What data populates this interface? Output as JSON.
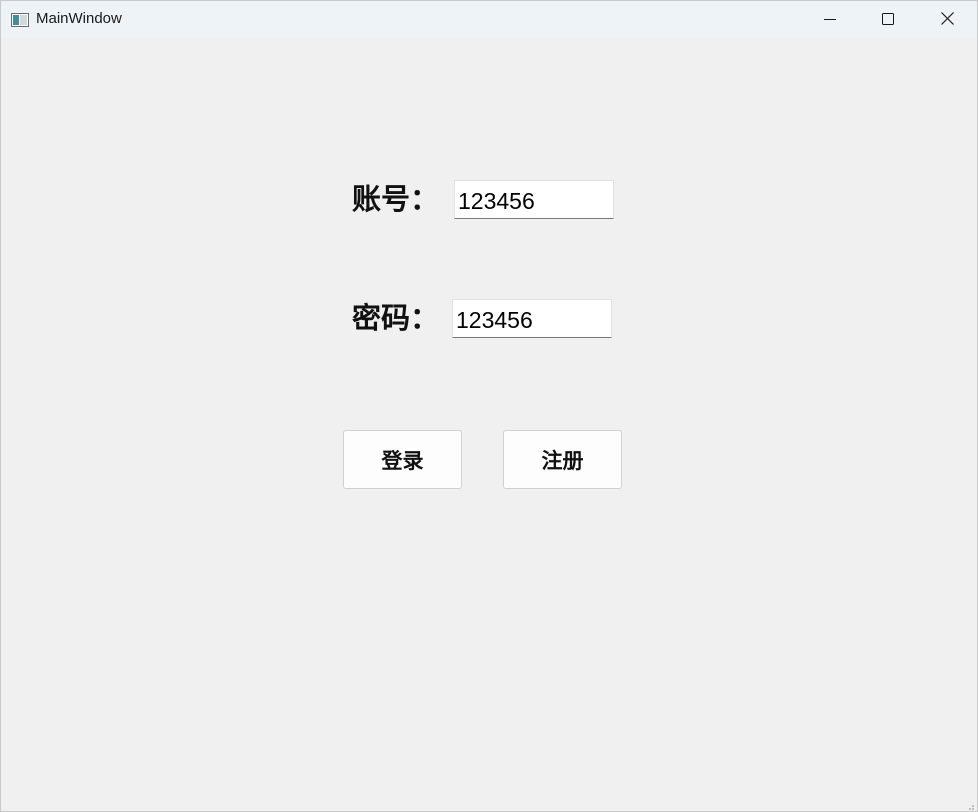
{
  "window": {
    "title": "MainWindow",
    "icon": "app-window-icon",
    "controls": {
      "minimize": "minimize-icon",
      "maximize": "maximize-icon",
      "close": "close-icon"
    }
  },
  "form": {
    "account_label": "账号：",
    "account_value": "123456",
    "password_label": "密码：",
    "password_value": "123456"
  },
  "actions": {
    "login_label": "登录",
    "register_label": "注册"
  }
}
